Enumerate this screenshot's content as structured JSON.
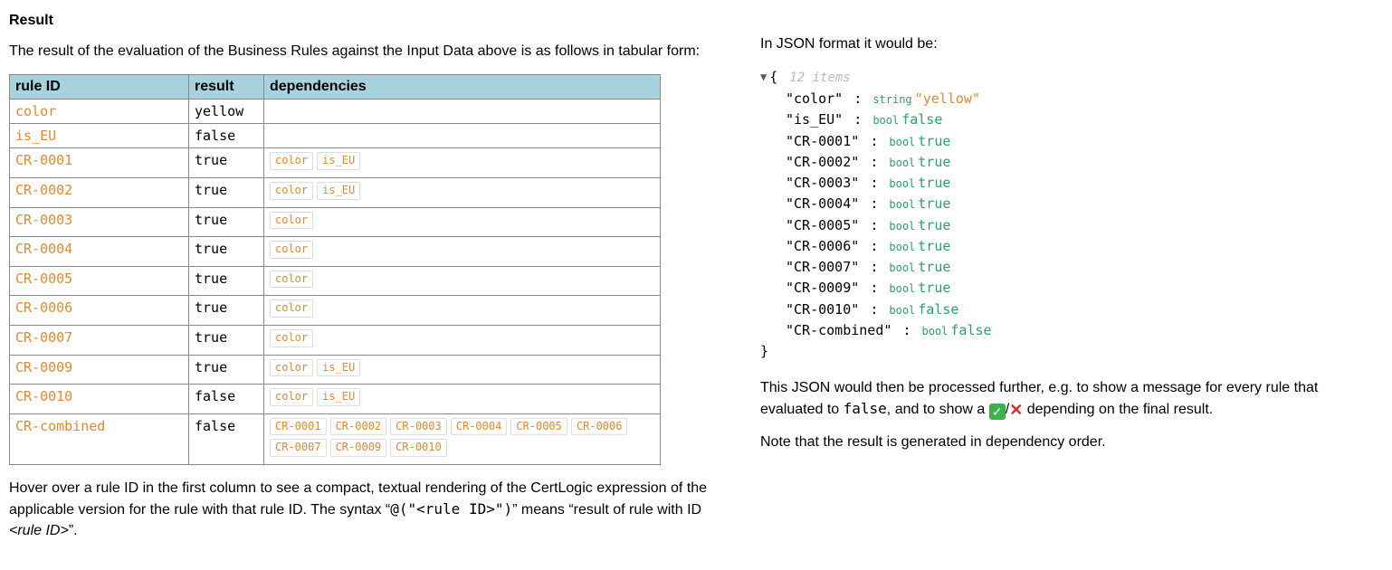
{
  "left": {
    "heading": "Result",
    "intro": "The result of the evaluation of the Business Rules against the Input Data above is as follows in tabular form:",
    "columns": {
      "id": "rule ID",
      "result": "result",
      "deps": "dependencies"
    },
    "rows": [
      {
        "id": "color",
        "result": "yellow",
        "deps": []
      },
      {
        "id": "is_EU",
        "result": "false",
        "deps": []
      },
      {
        "id": "CR-0001",
        "result": "true",
        "deps": [
          "color",
          "is_EU"
        ]
      },
      {
        "id": "CR-0002",
        "result": "true",
        "deps": [
          "color",
          "is_EU"
        ]
      },
      {
        "id": "CR-0003",
        "result": "true",
        "deps": [
          "color"
        ]
      },
      {
        "id": "CR-0004",
        "result": "true",
        "deps": [
          "color"
        ]
      },
      {
        "id": "CR-0005",
        "result": "true",
        "deps": [
          "color"
        ]
      },
      {
        "id": "CR-0006",
        "result": "true",
        "deps": [
          "color"
        ]
      },
      {
        "id": "CR-0007",
        "result": "true",
        "deps": [
          "color"
        ]
      },
      {
        "id": "CR-0009",
        "result": "true",
        "deps": [
          "color",
          "is_EU"
        ]
      },
      {
        "id": "CR-0010",
        "result": "false",
        "deps": [
          "color",
          "is_EU"
        ]
      },
      {
        "id": "CR-combined",
        "result": "false",
        "deps": [
          "CR-0001",
          "CR-0002",
          "CR-0003",
          "CR-0004",
          "CR-0005",
          "CR-0006",
          "CR-0007",
          "CR-0009",
          "CR-0010"
        ]
      }
    ],
    "hint_pre": "Hover over a rule ID in the first column to see a compact, textual rendering of the CertLogic expression of the applicable version for the rule with that rule ID. The syntax “",
    "hint_code": "@(\"<rule ID>\")",
    "hint_mid": "” means “result of rule with ID ",
    "hint_em": "<rule ID>",
    "hint_post": "”."
  },
  "right": {
    "intro": "In JSON format it would be:",
    "items_label": "12 items",
    "brace_open": "{",
    "brace_close": "}",
    "entries": [
      {
        "key": "color",
        "type": "string",
        "value": "\"yellow\"",
        "cls": "string"
      },
      {
        "key": "is_EU",
        "type": "bool",
        "value": "false",
        "cls": "bool"
      },
      {
        "key": "CR-0001",
        "type": "bool",
        "value": "true",
        "cls": "bool"
      },
      {
        "key": "CR-0002",
        "type": "bool",
        "value": "true",
        "cls": "bool"
      },
      {
        "key": "CR-0003",
        "type": "bool",
        "value": "true",
        "cls": "bool"
      },
      {
        "key": "CR-0004",
        "type": "bool",
        "value": "true",
        "cls": "bool"
      },
      {
        "key": "CR-0005",
        "type": "bool",
        "value": "true",
        "cls": "bool"
      },
      {
        "key": "CR-0006",
        "type": "bool",
        "value": "true",
        "cls": "bool"
      },
      {
        "key": "CR-0007",
        "type": "bool",
        "value": "true",
        "cls": "bool"
      },
      {
        "key": "CR-0009",
        "type": "bool",
        "value": "true",
        "cls": "bool"
      },
      {
        "key": "CR-0010",
        "type": "bool",
        "value": "false",
        "cls": "bool"
      },
      {
        "key": "CR-combined",
        "type": "bool",
        "value": "false",
        "cls": "bool"
      }
    ],
    "para2_pre": "This JSON would then be processed further, e.g. to show a message for every rule that evaluated to ",
    "para2_false": "false",
    "para2_mid": ", and to show a ",
    "para2_slash": "/",
    "para2_post": " depending on the final result.",
    "para3": "Note that the result is generated in dependency order."
  }
}
